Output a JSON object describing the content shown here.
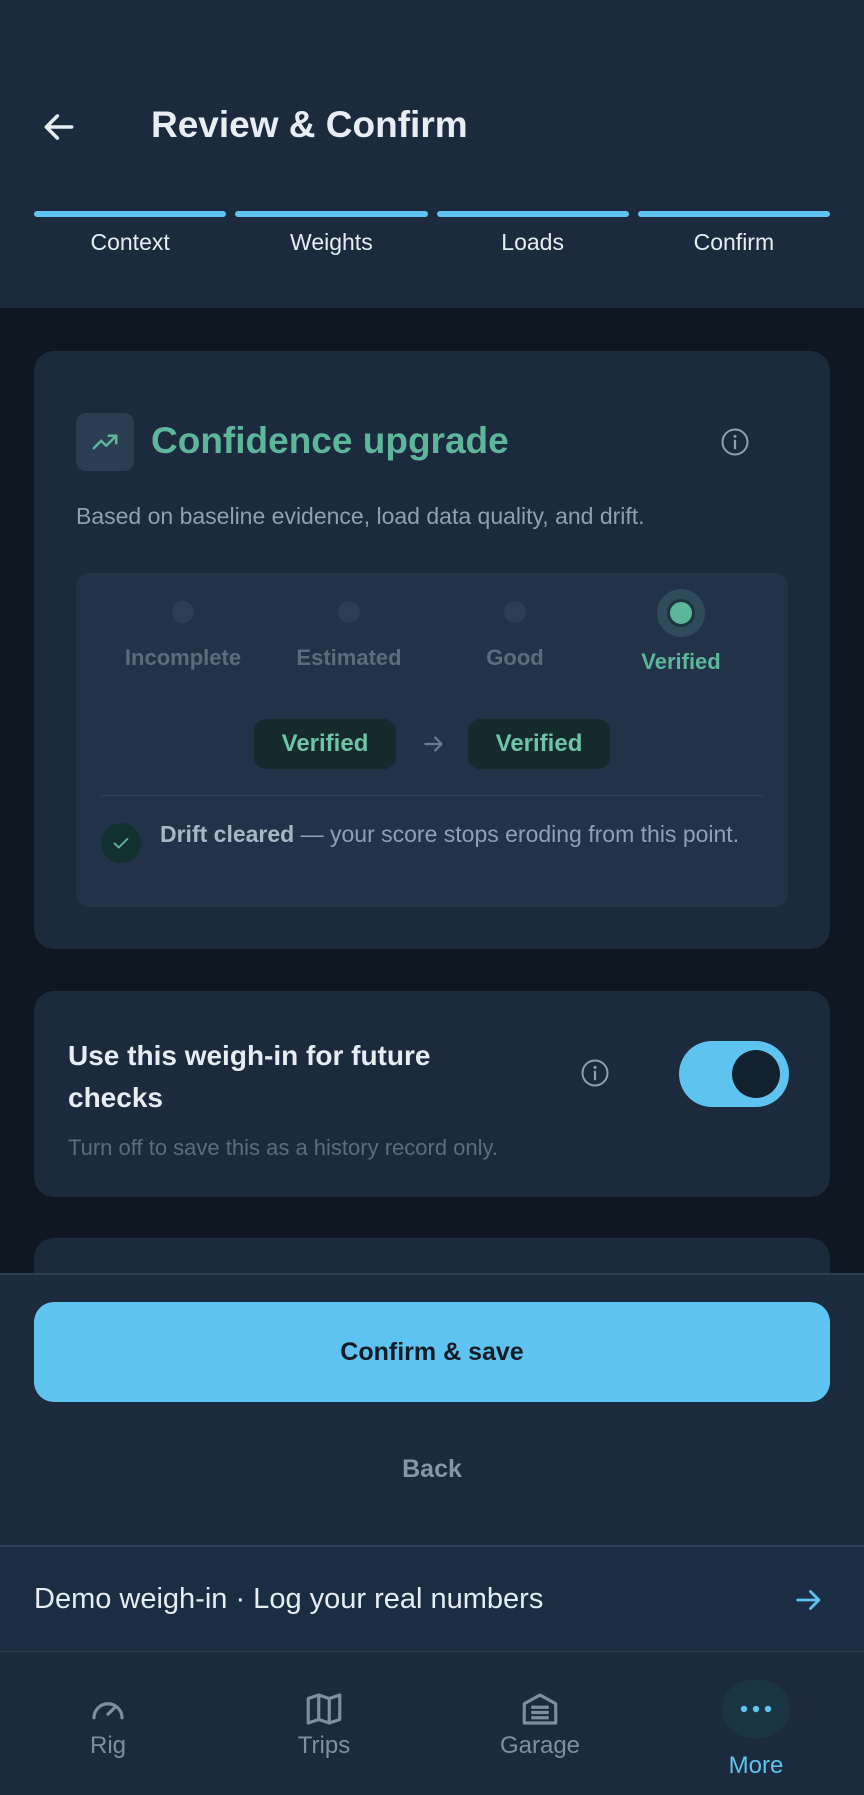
{
  "header": {
    "title": "Review & Confirm",
    "steps": [
      "Context",
      "Weights",
      "Loads",
      "Confirm"
    ]
  },
  "confidence": {
    "title": "Confidence upgrade",
    "subtitle": "Based on baseline evidence, load data quality, and drift.",
    "levels": [
      "Incomplete",
      "Estimated",
      "Good",
      "Verified"
    ],
    "current_level": "Verified",
    "from": "Verified",
    "to": "Verified",
    "drift_bold": "Drift cleared",
    "drift_rest": " — your score stops eroding from this point."
  },
  "future": {
    "title": "Use this weigh-in for future checks",
    "subtitle": "Turn off to save this as a history record only.",
    "enabled": true
  },
  "actions": {
    "confirm": "Confirm & save",
    "back": "Back"
  },
  "demo_banner": {
    "text": "Demo weigh-in · Log your real numbers"
  },
  "nav": {
    "items": [
      "Rig",
      "Trips",
      "Garage",
      "More"
    ],
    "active": "More"
  },
  "colors": {
    "accent": "#5ec3ef",
    "verified": "#5db59a",
    "surface": "#1b2a3d",
    "background": "#0f1822"
  }
}
